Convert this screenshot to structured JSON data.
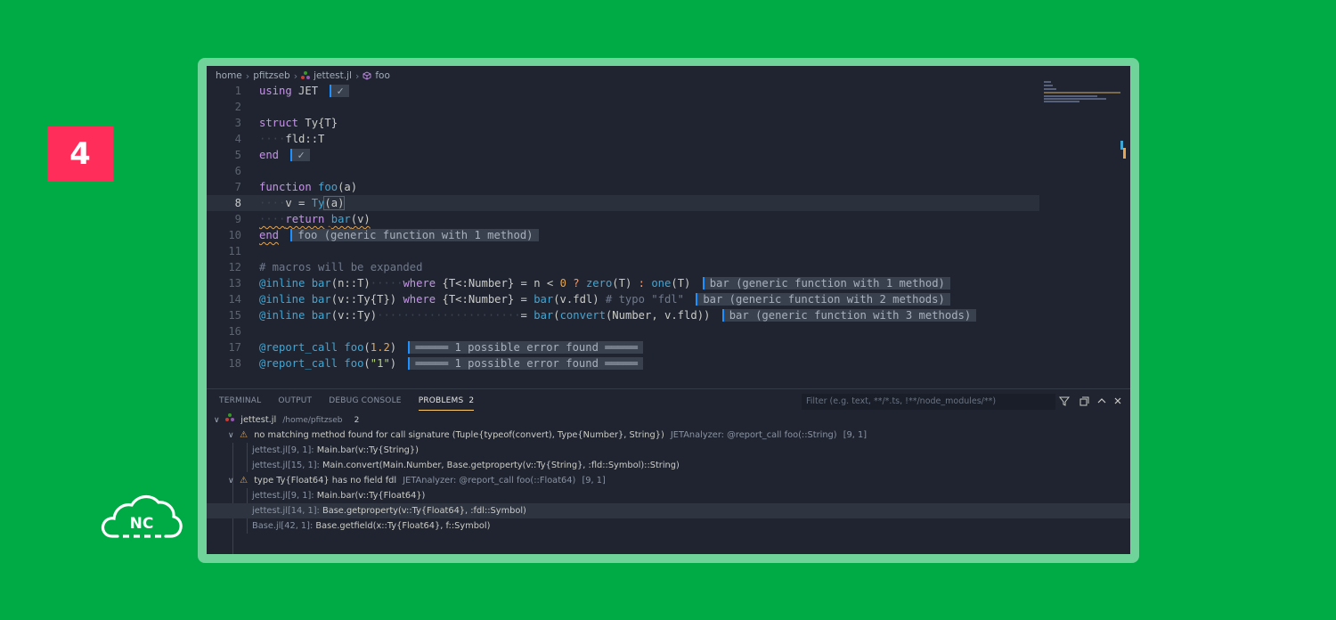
{
  "badge": "4",
  "logo_text": "NC",
  "breadcrumb": {
    "home": "home",
    "user": "pfitzseb",
    "file": "jettest.jl",
    "symbol": "foo"
  },
  "code": {
    "l1": {
      "n": "1",
      "kw": "using",
      "rest": " JET",
      "hint": "✓"
    },
    "l2": {
      "n": "2"
    },
    "l3": {
      "n": "3",
      "kw": "struct",
      "rest": " Ty{T}"
    },
    "l4": {
      "n": "4",
      "dots": "····",
      "rest": "fld::T"
    },
    "l5": {
      "n": "5",
      "kw": "end",
      "hint": "✓"
    },
    "l6": {
      "n": "6"
    },
    "l7": {
      "n": "7",
      "kw": "function",
      "fn": "foo",
      "rest": "(a)"
    },
    "l8": {
      "n": "8",
      "dots": "····",
      "a": "v = ",
      "fn": "Ty",
      "b": "(a)"
    },
    "l9": {
      "n": "9",
      "dots": "····",
      "kw": "return",
      "fn": "bar",
      "rest": "(v)"
    },
    "l10": {
      "n": "10",
      "kw": "end",
      "hint": "foo (generic function with 1 method)"
    },
    "l11": {
      "n": "11"
    },
    "l12": {
      "n": "12",
      "cmt": "# macros will be expanded"
    },
    "l13": {
      "n": "13",
      "mac": "@inline",
      "fn": "bar",
      "a": "(n::T)",
      "dots": "·····",
      "kw": "where",
      "b": " {T<:Number} = n < ",
      "num": "0",
      "op": " ?",
      "fn2": "zero",
      "c": "(T) ",
      "op2": ":",
      "fn3": "one",
      "d": "(T)",
      "hint": "bar (generic function with 1 method)"
    },
    "l14": {
      "n": "14",
      "mac": "@inline",
      "fn": "bar",
      "a": "(v::Ty{T}) ",
      "kw": "where",
      "b": " {T<:Number} = ",
      "fn2": "bar",
      "c": "(v.fdl) ",
      "cmt": "# typo \"fdl\"",
      "hint": "bar (generic function with 2 methods)"
    },
    "l15": {
      "n": "15",
      "mac": "@inline",
      "fn": "bar",
      "a": "(v::Ty)",
      "dots": "······················",
      "b": "= ",
      "fn2": "bar",
      "c": "(",
      "fn3": "convert",
      "d": "(Number, v.fld))",
      "hint": "bar (generic function with 3 methods)"
    },
    "l16": {
      "n": "16"
    },
    "l17": {
      "n": "17",
      "mac": "@report_call",
      "fn": "foo",
      "a": "(",
      "num": "1.2",
      "b": ")",
      "hint": "═════ 1 possible error found ═════"
    },
    "l18": {
      "n": "18",
      "mac": "@report_call",
      "fn": "foo",
      "a": "(",
      "str": "\"1\"",
      "b": ")",
      "hint": "═════ 1 possible error found ═════"
    }
  },
  "panel": {
    "tabs": [
      "TERMINAL",
      "OUTPUT",
      "DEBUG CONSOLE",
      "PROBLEMS"
    ],
    "problems_count": "2",
    "filter_placeholder": "Filter (e.g. text, **/*.ts, !**/node_modules/**)",
    "file": {
      "name": "jettest.jl",
      "path": "/home/pfitzseb",
      "count": "2"
    },
    "p1": {
      "msg": "no matching method found for call signature (Tuple{typeof(convert), Type{Number}, String})",
      "source": "JETAnalyzer: @report_call foo(::String)",
      "pos": "[9, 1]",
      "frames": [
        {
          "loc": "jettest.jl[9, 1]:",
          "text": "Main.bar(v::Ty{String})"
        },
        {
          "loc": "jettest.jl[15, 1]:",
          "text": "Main.convert(Main.Number, Base.getproperty(v::Ty{String}, :fld::Symbol)::String)"
        }
      ]
    },
    "p2": {
      "msg": "type Ty{Float64} has no field fdl",
      "source": "JETAnalyzer: @report_call foo(::Float64)",
      "pos": "[9, 1]",
      "frames": [
        {
          "loc": "jettest.jl[9, 1]:",
          "text": "Main.bar(v::Ty{Float64})"
        },
        {
          "loc": "jettest.jl[14, 1]:",
          "text": "Base.getproperty(v::Ty{Float64}, :fdl::Symbol)"
        },
        {
          "loc": "Base.jl[42, 1]:",
          "text": "Base.getfield(x::Ty{Float64}, f::Symbol)"
        }
      ]
    }
  }
}
